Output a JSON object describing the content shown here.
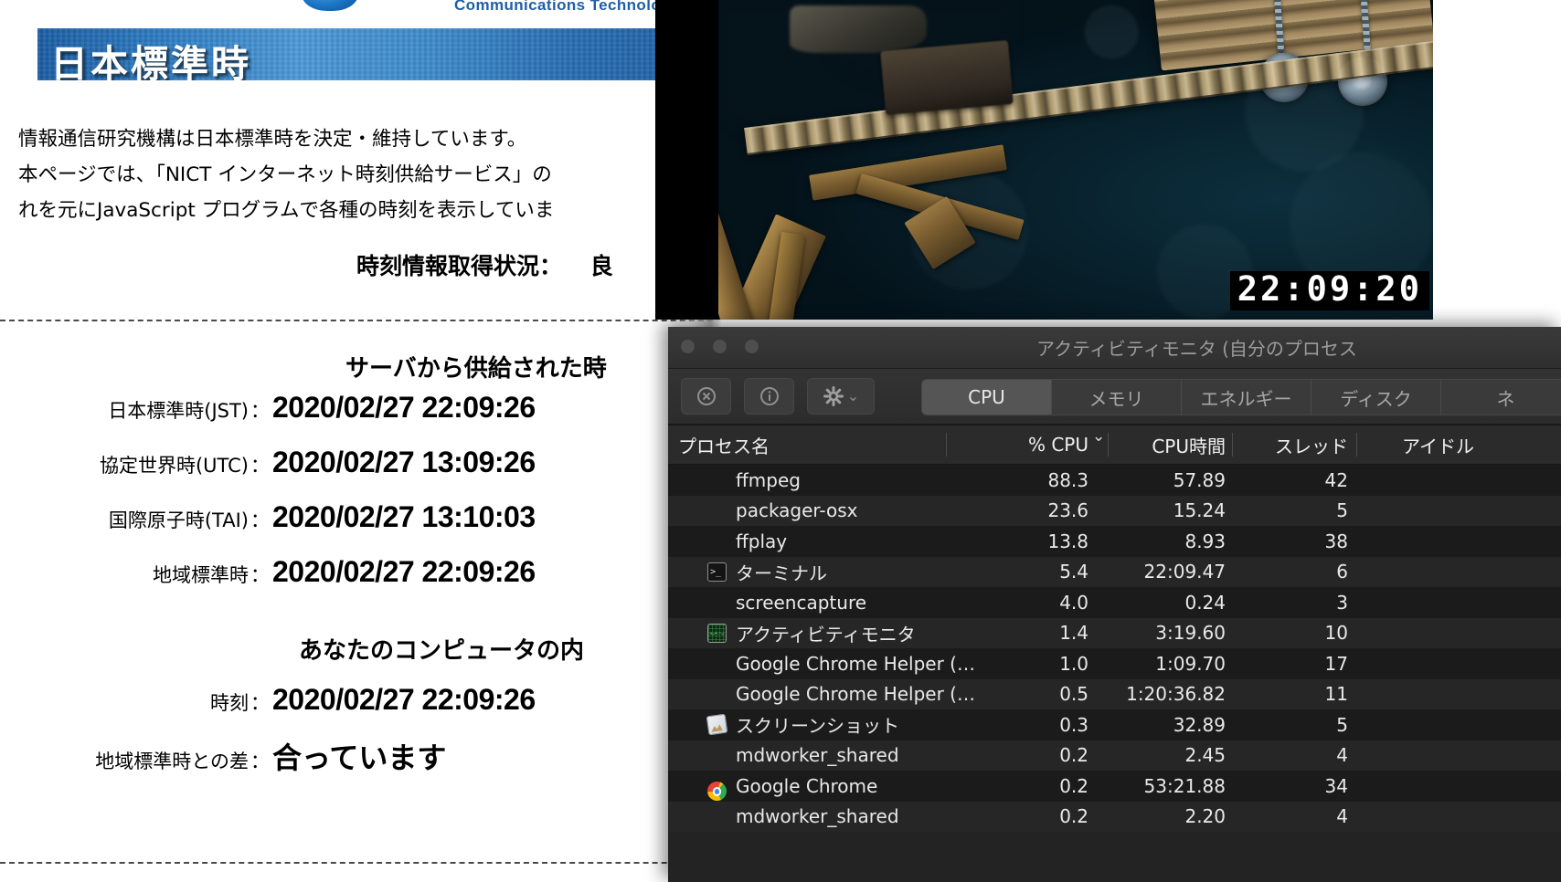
{
  "nict": {
    "logo_text": "Communications Technology",
    "banner_title": "日本標準時",
    "paragraph": [
      "情報通信研究機構は日本標準時を決定・維持しています。",
      "本ページでは、「NICT インターネット時刻供給サービス」の",
      "れを元にJavaScript プログラムで各種の時刻を表示していま"
    ],
    "status_label": "時刻情報取得状況：",
    "status_value": "良",
    "server_section": {
      "heading": "サーバから供給された時",
      "rows": [
        {
          "label": "日本標準時(JST)",
          "value": "2020/02/27 22:09:26"
        },
        {
          "label": "協定世界時(UTC)",
          "value": "2020/02/27 13:09:26"
        },
        {
          "label": "国際原子時(TAI)",
          "value": "2020/02/27 13:10:03"
        },
        {
          "label": "地域標準時",
          "value": "2020/02/27 22:09:26"
        }
      ]
    },
    "local_section": {
      "heading": "あなたのコンピュータの内",
      "rows": [
        {
          "label": "時刻",
          "value": "2020/02/27 22:09:26"
        },
        {
          "label": "地域標準時との差",
          "value": "合っています"
        }
      ]
    }
  },
  "video": {
    "timestamp": "22:09:20"
  },
  "activity_monitor": {
    "window_title": "アクティビティモニタ (自分のプロセス",
    "toolbar": {
      "stop_icon": "stop-process-icon",
      "info_icon": "inspect-process-icon",
      "gear_icon": "gear-icon",
      "gear_caret": "⌄"
    },
    "tabs": [
      {
        "label": "CPU",
        "active": true
      },
      {
        "label": "メモリ",
        "active": false
      },
      {
        "label": "エネルギー",
        "active": false
      },
      {
        "label": "ディスク",
        "active": false
      },
      {
        "label": "ネ",
        "active": false
      }
    ],
    "columns": {
      "name": "プロセス名",
      "cpu": "% CPU",
      "cpu_sort_caret": "⌄",
      "cpu_time": "CPU時間",
      "threads": "スレッド",
      "idle": "アイドル"
    },
    "rows": [
      {
        "icon": "",
        "name": "ffmpeg",
        "cpu": "88.3",
        "cpu_time": "57.89",
        "threads": "42"
      },
      {
        "icon": "",
        "name": "packager-osx",
        "cpu": "23.6",
        "cpu_time": "15.24",
        "threads": "5"
      },
      {
        "icon": "",
        "name": "ffplay",
        "cpu": "13.8",
        "cpu_time": "8.93",
        "threads": "38"
      },
      {
        "icon": "terminal-icon",
        "name": "ターミナル",
        "cpu": "5.4",
        "cpu_time": "22:09.47",
        "threads": "6"
      },
      {
        "icon": "",
        "name": "screencapture",
        "cpu": "4.0",
        "cpu_time": "0.24",
        "threads": "3"
      },
      {
        "icon": "activity-icon",
        "name": "アクティビティモニタ",
        "cpu": "1.4",
        "cpu_time": "3:19.60",
        "threads": "10"
      },
      {
        "icon": "",
        "name": "Google Chrome Helper (…",
        "cpu": "1.0",
        "cpu_time": "1:09.70",
        "threads": "17"
      },
      {
        "icon": "",
        "name": "Google Chrome Helper (…",
        "cpu": "0.5",
        "cpu_time": "1:20:36.82",
        "threads": "11"
      },
      {
        "icon": "screenshot-icon",
        "name": "スクリーンショット",
        "cpu": "0.3",
        "cpu_time": "32.89",
        "threads": "5"
      },
      {
        "icon": "",
        "name": "mdworker_shared",
        "cpu": "0.2",
        "cpu_time": "2.45",
        "threads": "4"
      },
      {
        "icon": "chrome-icon",
        "name": "Google Chrome",
        "cpu": "0.2",
        "cpu_time": "53:21.88",
        "threads": "34"
      },
      {
        "icon": "",
        "name": "mdworker_shared",
        "cpu": "0.2",
        "cpu_time": "2.20",
        "threads": "4"
      }
    ]
  },
  "colors": {
    "banner_blue": "#2f7dc4",
    "window_chrome": "#2f2f2f",
    "row_odd": "#1b1b1b",
    "row_even": "#262626",
    "text_primary": "#e9e9e9"
  }
}
